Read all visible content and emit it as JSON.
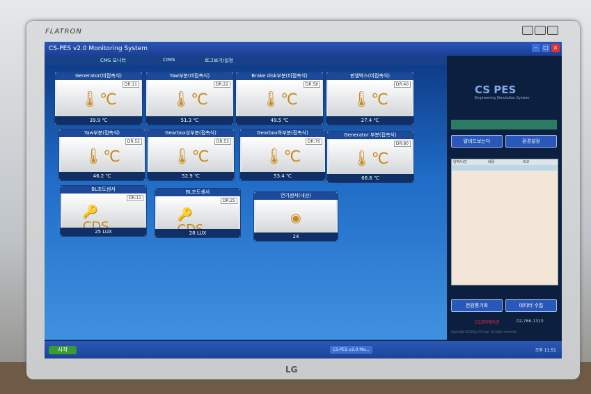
{
  "monitor": {
    "brand": "FLATRON",
    "maker": "LG"
  },
  "window": {
    "title": "CS-PES v2.0 Monitoring System"
  },
  "tabs": [
    "CMS 모니터",
    "CIMS",
    "로그보기/설정"
  ],
  "tiles": [
    {
      "title": "Generator(비접촉식)",
      "code": "DR:11",
      "value": "39.9 ℃",
      "icon": "thermometer-icon"
    },
    {
      "title": "Yaw부분(비접촉식)",
      "code": "DR:22",
      "value": "51.3 ℃",
      "icon": "thermometer-icon"
    },
    {
      "title": "Brake disk부분(비접촉식)",
      "code": "DR:58",
      "value": "49.5 ℃",
      "icon": "thermometer-icon"
    },
    {
      "title": "판넬박스(비접촉식)",
      "code": "DR:40",
      "value": "27.4 ℃",
      "icon": "thermometer-icon"
    },
    {
      "title": "Yaw부분(접촉식)",
      "code": "DR:52",
      "value": "46.2 ℃",
      "icon": "thermometer-icon"
    },
    {
      "title": "Gearbox상부분(접촉식)",
      "code": "DR:53",
      "value": "52.9 ℃",
      "icon": "thermometer-icon"
    },
    {
      "title": "Gearbox하부분(접촉식)",
      "code": "DR:70",
      "value": "53.4 ℃",
      "icon": "thermometer-icon"
    },
    {
      "title": "Generator 부분(접촉식)",
      "code": "DR:80",
      "value": "66.6 ℃",
      "icon": "thermometer-icon"
    },
    {
      "title": "BL조도센서",
      "code": "DR:11",
      "value": "25 LUX",
      "icon": "lux-sensor-icon"
    },
    {
      "title": "BL조도센서",
      "code": "DR:25",
      "value": "28 LUX",
      "icon": "lux-sensor-icon"
    },
    {
      "title": "연기센서(내선)",
      "code": "",
      "value": "24",
      "icon": "smoke-sensor-icon"
    }
  ],
  "right_panel": {
    "logo": "CS PES",
    "subtitle": "Engineering Simulation System",
    "buttons": [
      "알비드보는다",
      "환경설정"
    ],
    "grid_headers": [
      "날짜/시간",
      "내용",
      "비고"
    ],
    "bottom_buttons": [
      "전원통기화",
      "데이터 수집"
    ],
    "company": "CS코퍼레이션",
    "phone": "02-766-1310",
    "copyright": "Copyright 2010 by CS Corp. All rights reserved."
  },
  "taskbar": {
    "start": "시작",
    "items": [
      "CS-PES v2.0 Mo..."
    ],
    "clock": "오후 11:51"
  },
  "colors": {
    "titlebar": "#1b3f93",
    "tile_header": "#1c4a99",
    "thermo": "#c98a1b",
    "panel": "#0d1f3e"
  }
}
